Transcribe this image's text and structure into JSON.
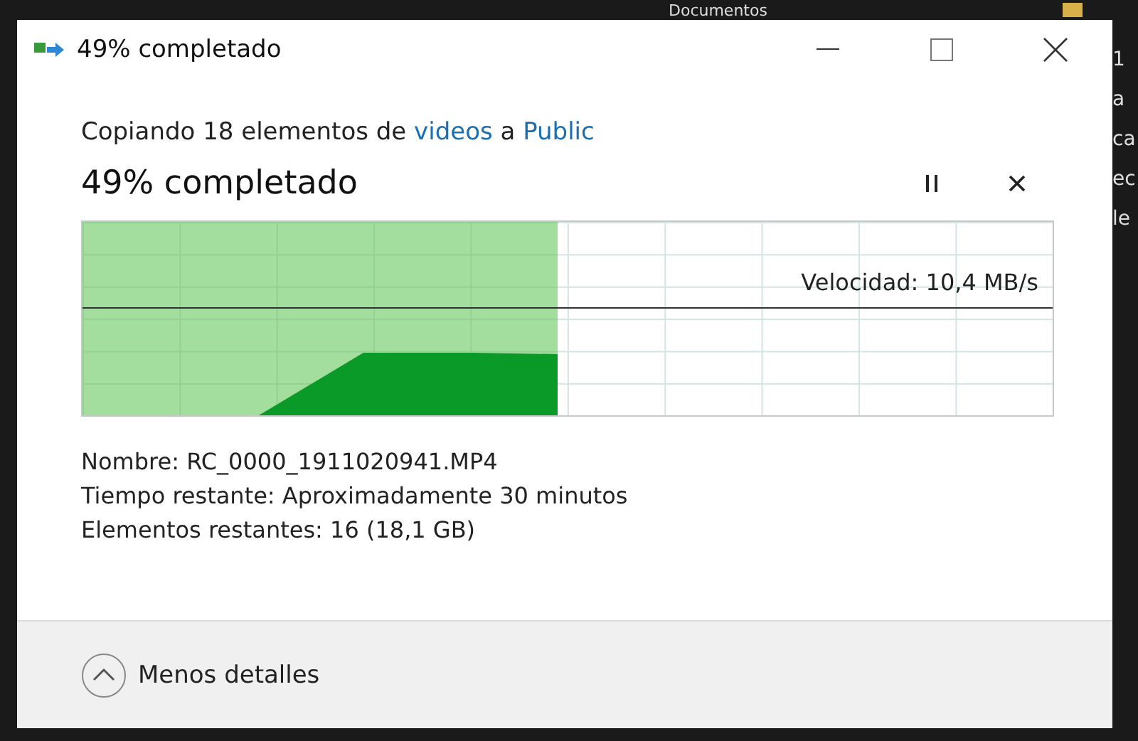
{
  "background_window": {
    "folder_label": "Documentos",
    "side_texts": [
      "1",
      "a",
      "ca",
      "ec",
      "le"
    ]
  },
  "window": {
    "title": "49% completado"
  },
  "copy": {
    "prefix": "Copiando 18 elementos de",
    "source": "videos",
    "joiner": "a",
    "destination": "Public"
  },
  "progress": {
    "heading": "49% completado",
    "level": 0.49,
    "speed": "Velocidad: 10,4 MB/s"
  },
  "details": [
    {
      "label": "Nombre:",
      "value": "RC_0000_1911020941.MP4"
    },
    {
      "label": "Tiempo restante:",
      "value": "Aproximadamente 30 minutos"
    },
    {
      "label": "Elementos restantes:",
      "value": "16 (18,1 GB)"
    }
  ],
  "footer": {
    "toggle": "Menos detalles",
    "expanded": true
  }
}
